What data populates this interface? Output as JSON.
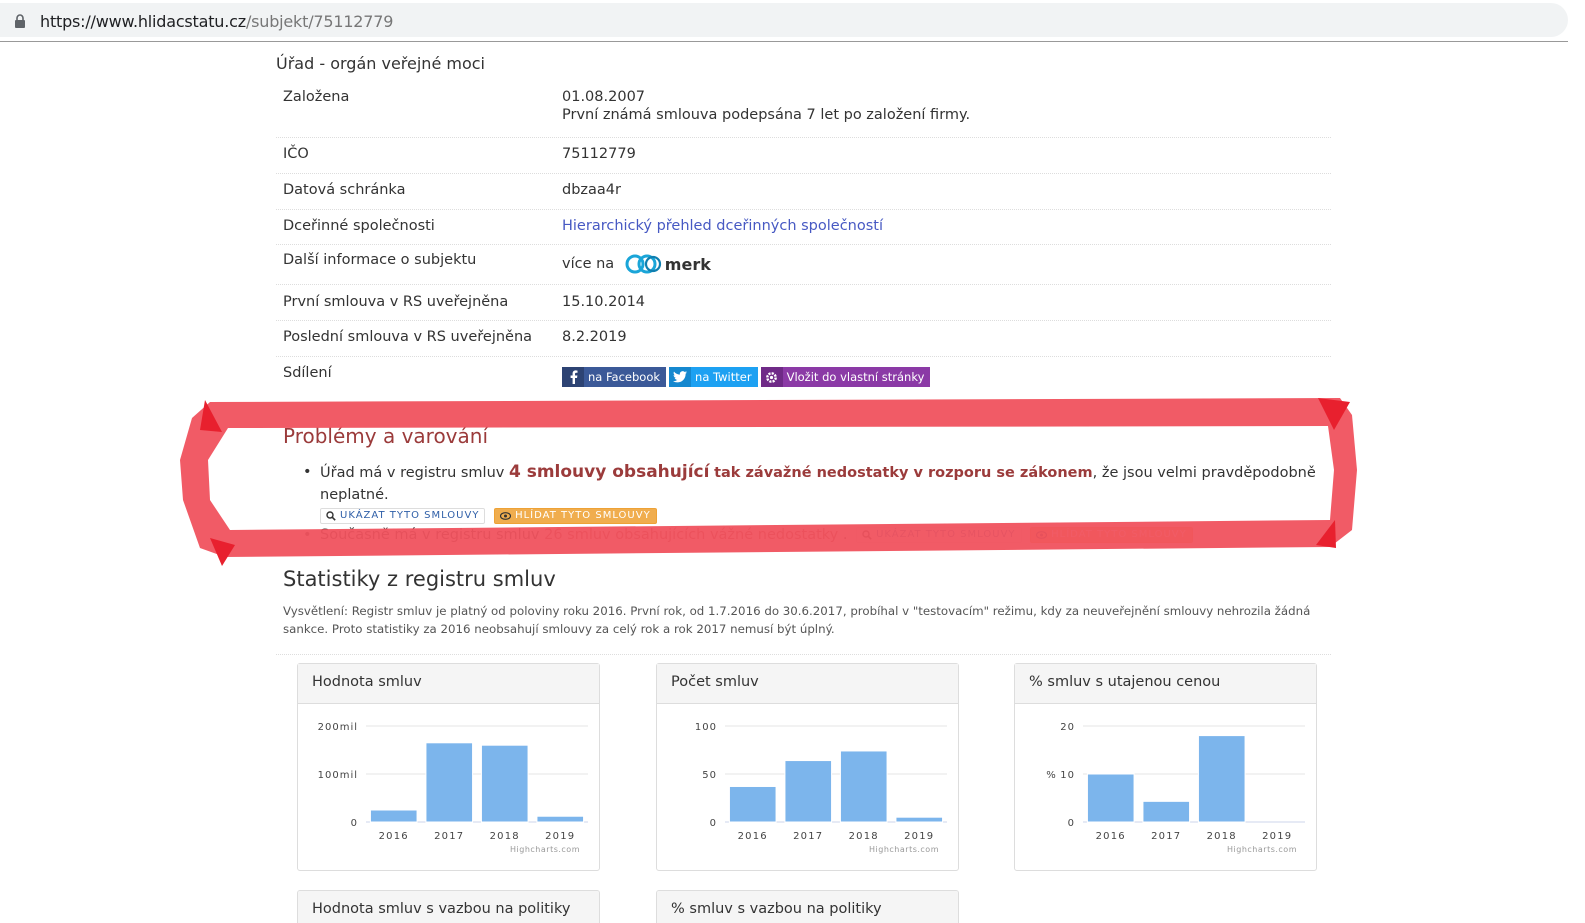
{
  "browser": {
    "url_host": "https://www.hlidacstatu.cz",
    "url_path": "/subjekt/75112779"
  },
  "section_head": "Úřad - orgán veřejné moci",
  "info": {
    "founded_label": "Založena",
    "founded_value": "01.08.2007",
    "founded_note": "První známá smlouva podepsána 7 let po založení firmy.",
    "ico_label": "IČO",
    "ico_value": "75112779",
    "databox_label": "Datová schránka",
    "databox_value": "dbzaa4r",
    "subsidiaries_label": "Dceřinné společnosti",
    "subsidiaries_link": "Hierarchický přehled dceřinných společností",
    "more_label": "Další informace o subjektu",
    "more_prefix": "více na",
    "merk_logo": "merk",
    "first_contract_label": "První smlouva v RS uveřejněna",
    "first_contract_value": "15.10.2014",
    "last_contract_label": "Poslední smlouva v RS uveřejněna",
    "last_contract_value": "8.2.2019",
    "sharing_label": "Sdílení",
    "share_facebook": "na Facebook",
    "share_twitter": "na Twitter",
    "share_embed": "Vložit do vlastní stránky"
  },
  "warnings": {
    "title": "Problémy a varování",
    "item1_prefix": "Úřad má v registru smluv",
    "item1_big": "4 smlouvy obsahující",
    "item1_bold": "tak závažné nedostatky v rozporu se zákonem",
    "item1_suffix": ", že jsou velmi pravděpodobně neplatné.",
    "item2_prefix": "Současně má v registru smluv",
    "item2_link": "26 smluv obsahujících vážné nedostatky",
    "item2_suffix": " .",
    "btn_show": "UKÁZAT TYTO SMLOUVY",
    "btn_watch": "HLÍDAT TYTO SMLOUVY"
  },
  "stats": {
    "title": "Statistiky z registru smluv",
    "note": "Vysvětlení: Registr smluv je platný od poloviny roku 2016. První rok, od 1.7.2016 do 30.6.2017, probíhal v \"testovacím\" režimu, kdy za neuveřejnění smlouvy nehrozila žádná sankce. Proto statistiky za 2016 neobsahují smlouvy za celý rok a rok 2017 nemusí být úplný.",
    "partial_titles": [
      "Hodnota smluv s vazbou na politiky",
      "% smluv s vazbou na politiky"
    ]
  },
  "chart_data": [
    {
      "type": "bar",
      "title": "Hodnota smluv",
      "categories": [
        "2016",
        "2017",
        "2018",
        "2019"
      ],
      "values": [
        25000000,
        165000000,
        160000000,
        12000000
      ],
      "yticks": [
        "0",
        "100mil",
        "200mil"
      ],
      "ylim": [
        0,
        200000000
      ],
      "ylabel": "",
      "credit": "Highcharts.com",
      "color": "#7cb5ec"
    },
    {
      "type": "bar",
      "title": "Počet smluv",
      "categories": [
        "2016",
        "2017",
        "2018",
        "2019"
      ],
      "values": [
        37,
        64,
        74,
        5
      ],
      "yticks": [
        "0",
        "50",
        "100"
      ],
      "ylim": [
        0,
        100
      ],
      "ylabel": "",
      "credit": "Highcharts.com",
      "color": "#7cb5ec"
    },
    {
      "type": "bar",
      "title": "% smluv s utajenou cenou",
      "categories": [
        "2016",
        "2017",
        "2018",
        "2019"
      ],
      "values": [
        10,
        4.3,
        18,
        0
      ],
      "yticks": [
        "0",
        "10",
        "20"
      ],
      "ylim": [
        0,
        20
      ],
      "ylabel": "%",
      "credit": "Highcharts.com",
      "color": "#7cb5ec"
    }
  ],
  "colors": {
    "annotation_red": "#f0525e",
    "bar": "#7cb5ec",
    "warning_title": "#9b3b3b"
  }
}
